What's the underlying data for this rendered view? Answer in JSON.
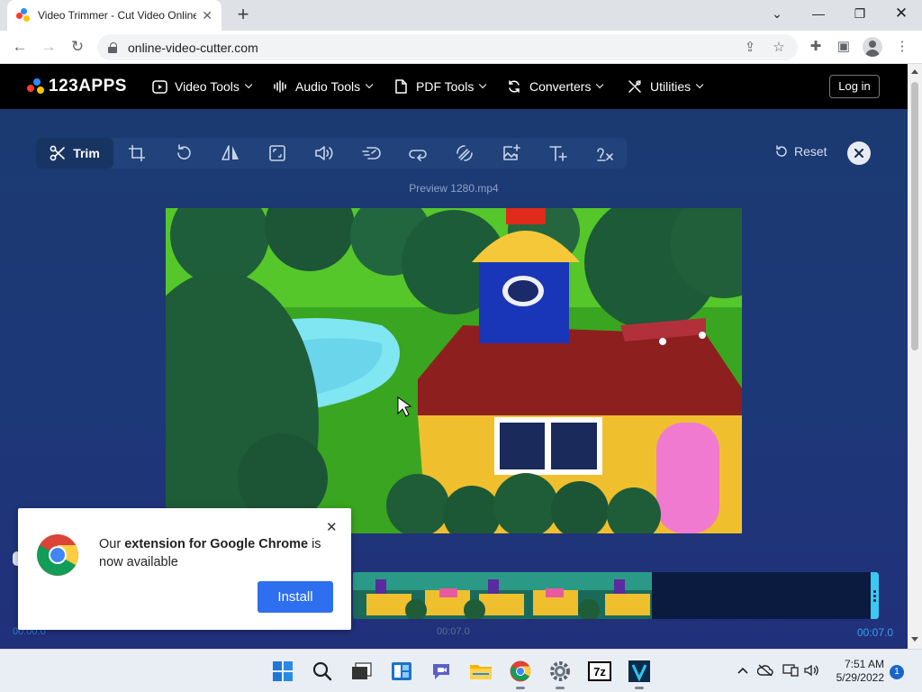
{
  "browser": {
    "tab_title": "Video Trimmer - Cut Video Online",
    "url": "online-video-cutter.com"
  },
  "site": {
    "logo": "123APPS",
    "menu": [
      {
        "label": "Video Tools",
        "icon": "video-icon"
      },
      {
        "label": "Audio Tools",
        "icon": "audio-waveform-icon"
      },
      {
        "label": "PDF Tools",
        "icon": "file-icon"
      },
      {
        "label": "Converters",
        "icon": "refresh-icon"
      },
      {
        "label": "Utilities",
        "icon": "tools-icon"
      }
    ],
    "login_label": "Log in"
  },
  "editor": {
    "tools": [
      {
        "name": "trim",
        "label": "Trim",
        "active": true
      },
      {
        "name": "crop"
      },
      {
        "name": "rotate"
      },
      {
        "name": "flip"
      },
      {
        "name": "resize"
      },
      {
        "name": "volume"
      },
      {
        "name": "speed"
      },
      {
        "name": "loop"
      },
      {
        "name": "stabilize"
      },
      {
        "name": "image"
      },
      {
        "name": "text"
      },
      {
        "name": "remove-logo"
      }
    ],
    "reset_label": "Reset",
    "preview_title": "Preview 1280.mp4",
    "timeline": {
      "start_time": "00:00.0",
      "mid_time": "00:07.0",
      "end_time": "00:07.0"
    }
  },
  "popup": {
    "text_prefix": "Our ",
    "text_bold": "extension for Google Chrome",
    "text_suffix": " is now available",
    "install_label": "Install"
  },
  "taskbar": {
    "time": "7:51 AM",
    "date": "5/29/2022",
    "notifications": "1"
  },
  "colors": {
    "editor_bg": "#1b3a72",
    "accent": "#2d6fef",
    "trim_handle": "#3bc9f0"
  }
}
